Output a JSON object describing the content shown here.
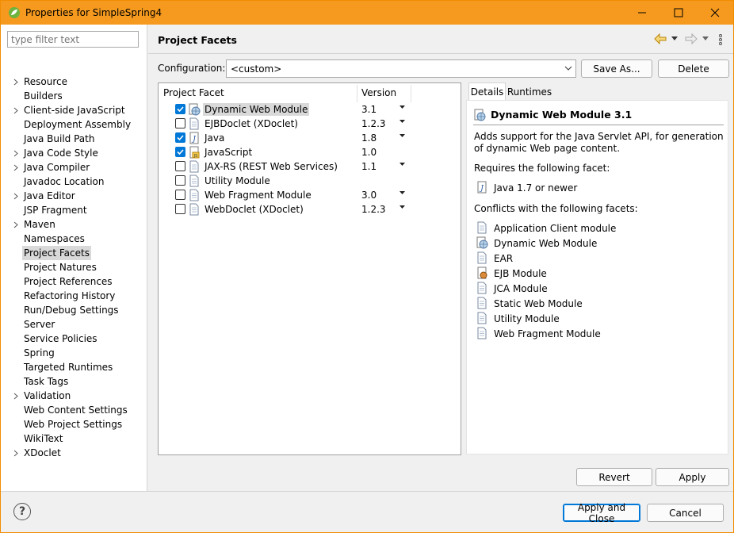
{
  "window": {
    "title": "Properties for SimpleSpring4",
    "minimize_glyph": "—",
    "maximize_glyph": "☐",
    "close_glyph": "✕"
  },
  "sidebar": {
    "filter_placeholder": "type filter text",
    "items": [
      {
        "label": "Resource",
        "expandable": true
      },
      {
        "label": "Builders",
        "expandable": false
      },
      {
        "label": "Client-side JavaScript",
        "expandable": true
      },
      {
        "label": "Deployment Assembly",
        "expandable": false
      },
      {
        "label": "Java Build Path",
        "expandable": false
      },
      {
        "label": "Java Code Style",
        "expandable": true
      },
      {
        "label": "Java Compiler",
        "expandable": true
      },
      {
        "label": "Javadoc Location",
        "expandable": false
      },
      {
        "label": "Java Editor",
        "expandable": true
      },
      {
        "label": "JSP Fragment",
        "expandable": false
      },
      {
        "label": "Maven",
        "expandable": true
      },
      {
        "label": "Namespaces",
        "expandable": false
      },
      {
        "label": "Project Facets",
        "expandable": false,
        "selected": true
      },
      {
        "label": "Project Natures",
        "expandable": false
      },
      {
        "label": "Project References",
        "expandable": false
      },
      {
        "label": "Refactoring History",
        "expandable": false
      },
      {
        "label": "Run/Debug Settings",
        "expandable": false
      },
      {
        "label": "Server",
        "expandable": false
      },
      {
        "label": "Service Policies",
        "expandable": false
      },
      {
        "label": "Spring",
        "expandable": false
      },
      {
        "label": "Targeted Runtimes",
        "expandable": false
      },
      {
        "label": "Task Tags",
        "expandable": false
      },
      {
        "label": "Validation",
        "expandable": true
      },
      {
        "label": "Web Content Settings",
        "expandable": false
      },
      {
        "label": "Web Project Settings",
        "expandable": false
      },
      {
        "label": "WikiText",
        "expandable": false
      },
      {
        "label": "XDoclet",
        "expandable": true
      }
    ]
  },
  "page": {
    "title": "Project Facets",
    "configuration_label": "Configuration:",
    "configuration_value": "<custom>",
    "save_as_label": "Save As...",
    "delete_label": "Delete"
  },
  "facets": {
    "col_facet": "Project Facet",
    "col_version": "Version",
    "rows": [
      {
        "name": "Dynamic Web Module",
        "version": "3.1",
        "checked": true,
        "has_dropdown": true,
        "icon": "web-module-icon",
        "selected": true
      },
      {
        "name": "EJBDoclet (XDoclet)",
        "version": "1.2.3",
        "checked": false,
        "has_dropdown": true,
        "icon": "document-icon"
      },
      {
        "name": "Java",
        "version": "1.8",
        "checked": true,
        "has_dropdown": true,
        "icon": "java-icon"
      },
      {
        "name": "JavaScript",
        "version": "1.0",
        "checked": true,
        "has_dropdown": false,
        "icon": "javascript-icon"
      },
      {
        "name": "JAX-RS (REST Web Services)",
        "version": "1.1",
        "checked": false,
        "has_dropdown": true,
        "icon": "document-icon"
      },
      {
        "name": "Utility Module",
        "version": "",
        "checked": false,
        "has_dropdown": false,
        "icon": "document-icon"
      },
      {
        "name": "Web Fragment Module",
        "version": "3.0",
        "checked": false,
        "has_dropdown": true,
        "icon": "document-icon"
      },
      {
        "name": "WebDoclet (XDoclet)",
        "version": "1.2.3",
        "checked": false,
        "has_dropdown": true,
        "icon": "document-icon"
      }
    ]
  },
  "details": {
    "tabs": [
      "Details",
      "Runtimes"
    ],
    "active_tab": "Details",
    "title": "Dynamic Web Module 3.1",
    "description": "Adds support for the Java Servlet API, for generation of dynamic Web page content.",
    "requires_label": "Requires the following facet:",
    "requires": [
      {
        "label": "Java 1.7 or newer",
        "icon": "java-icon"
      }
    ],
    "conflicts_label": "Conflicts with the following facets:",
    "conflicts": [
      {
        "label": "Application Client module",
        "icon": "document-icon"
      },
      {
        "label": "Dynamic Web Module",
        "icon": "web-module-icon"
      },
      {
        "label": "EAR",
        "icon": "document-icon"
      },
      {
        "label": "EJB Module",
        "icon": "ejb-icon"
      },
      {
        "label": "JCA Module",
        "icon": "document-icon"
      },
      {
        "label": "Static Web Module",
        "icon": "document-icon"
      },
      {
        "label": "Utility Module",
        "icon": "document-icon"
      },
      {
        "label": "Web Fragment Module",
        "icon": "document-icon"
      }
    ]
  },
  "buttons": {
    "revert": "Revert",
    "apply": "Apply",
    "apply_close": "Apply and Close",
    "cancel": "Cancel",
    "help": "?"
  },
  "colors": {
    "titlebar": "#f59a1f",
    "checkbox_checked": "#0078d7"
  }
}
